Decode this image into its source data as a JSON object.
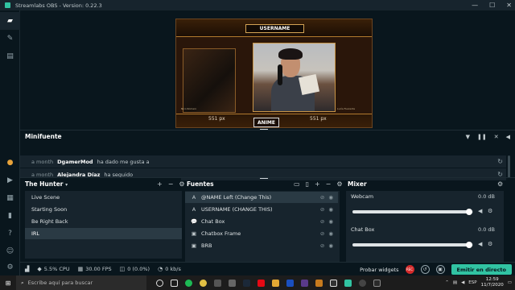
{
  "window": {
    "title": "Streamlabs OBS - Version: 0.22.3",
    "controls": [
      "—",
      "☐",
      "✕"
    ]
  },
  "sidebar": {
    "items": [
      {
        "name": "studio-editor",
        "icon": "layout-icon"
      },
      {
        "name": "themes",
        "icon": "brush-icon"
      },
      {
        "name": "store",
        "icon": "store-icon"
      },
      {
        "name": "alertbox",
        "icon": "bell-icon"
      },
      {
        "name": "recordings",
        "icon": "play-icon"
      },
      {
        "name": "layout",
        "icon": "grid-icon"
      },
      {
        "name": "stats",
        "icon": "chart-icon"
      },
      {
        "name": "help",
        "icon": "question-icon"
      },
      {
        "name": "account",
        "icon": "user-icon"
      },
      {
        "name": "settings",
        "icon": "gear-icon"
      }
    ]
  },
  "preview": {
    "username_banner": "USERNAME",
    "left_px": "551 px",
    "right_px": "551 px",
    "tag_left": "Nico Romero",
    "tag_right": "Lucía Fuerente",
    "logo_text": "ANIME"
  },
  "minifuente": {
    "title": "Minifuente",
    "events": [
      {
        "time": "a month",
        "user": "DgamerMod",
        "message": "ha dado me gusta a"
      },
      {
        "time": "a month",
        "user": "Alejandra Díaz",
        "message": "ha seguido"
      }
    ]
  },
  "scenes": {
    "title": "The Hunter",
    "items": [
      "Live Scene",
      "Starting Soon",
      "Be Right Back",
      "IRL"
    ],
    "selected": "IRL"
  },
  "sources": {
    "title": "Fuentes",
    "items": [
      {
        "icon": "A",
        "label": "@NAME Left (Change This)",
        "active": true
      },
      {
        "icon": "A",
        "label": "USERNAME (CHANGE THIS)",
        "active": false
      },
      {
        "icon": "💬",
        "label": "Chat Box",
        "active": false
      },
      {
        "icon": "▣",
        "label": "Chatbox Frame",
        "active": false
      },
      {
        "icon": "▣",
        "label": "BRB",
        "active": false
      }
    ]
  },
  "mixer": {
    "title": "Mixer",
    "channels": [
      {
        "name": "Webcam",
        "db": "0.0 dB",
        "level": 0.98
      },
      {
        "name": "Chat Box",
        "db": "0.0 dB",
        "level": 0.98
      }
    ]
  },
  "footer": {
    "cpu": "5.5% CPU",
    "fps": "30.00 FPS",
    "dropped": "0 (0.0%)",
    "bitrate": "0 kb/s",
    "test_widgets": "Probar widgets",
    "rec_label": "REC",
    "go_live": "Emitir en directo"
  },
  "taskbar": {
    "search_placeholder": "Escribe aquí para buscar",
    "language": "ESP",
    "time": "12:59",
    "date": "11/7/2020"
  },
  "colors": {
    "accent": "#31c3a2",
    "background": "#09161d",
    "panel": "#17242d",
    "record": "#d42a2a"
  }
}
